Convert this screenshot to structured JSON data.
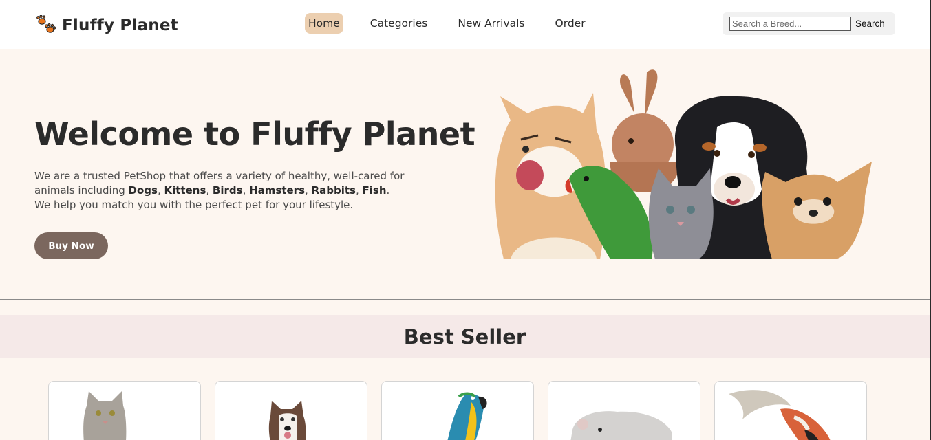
{
  "brand": {
    "name": "Fluffy Planet",
    "logo_icon": "paw-prints-icon",
    "accent": "#e8741c"
  },
  "nav": {
    "items": [
      {
        "label": "Home",
        "active": true
      },
      {
        "label": "Categories",
        "active": false
      },
      {
        "label": "New Arrivals",
        "active": false
      },
      {
        "label": "Order",
        "active": false
      }
    ]
  },
  "search": {
    "placeholder": "Search a Breed...",
    "button_label": "Search"
  },
  "hero": {
    "title": "Welcome to Fluffy Planet",
    "desc_lead": "We are a trusted PetShop that offers a variety of healthy, well-cared for animals including ",
    "animals": [
      "Dogs",
      "Kittens",
      "Birds",
      "Hamsters",
      "Rabbits",
      "Fish"
    ],
    "desc_tail": ". We help you match you with the perfect pet for your lifestyle.",
    "cta_label": "Buy Now",
    "cta_color": "#7b675e"
  },
  "best_seller": {
    "title": "Best Seller",
    "cards": [
      {
        "image": "cat-icon"
      },
      {
        "image": "husky-icon"
      },
      {
        "image": "parrot-icon"
      },
      {
        "image": "hamster-icon"
      },
      {
        "image": "koi-fish-icon"
      }
    ]
  }
}
